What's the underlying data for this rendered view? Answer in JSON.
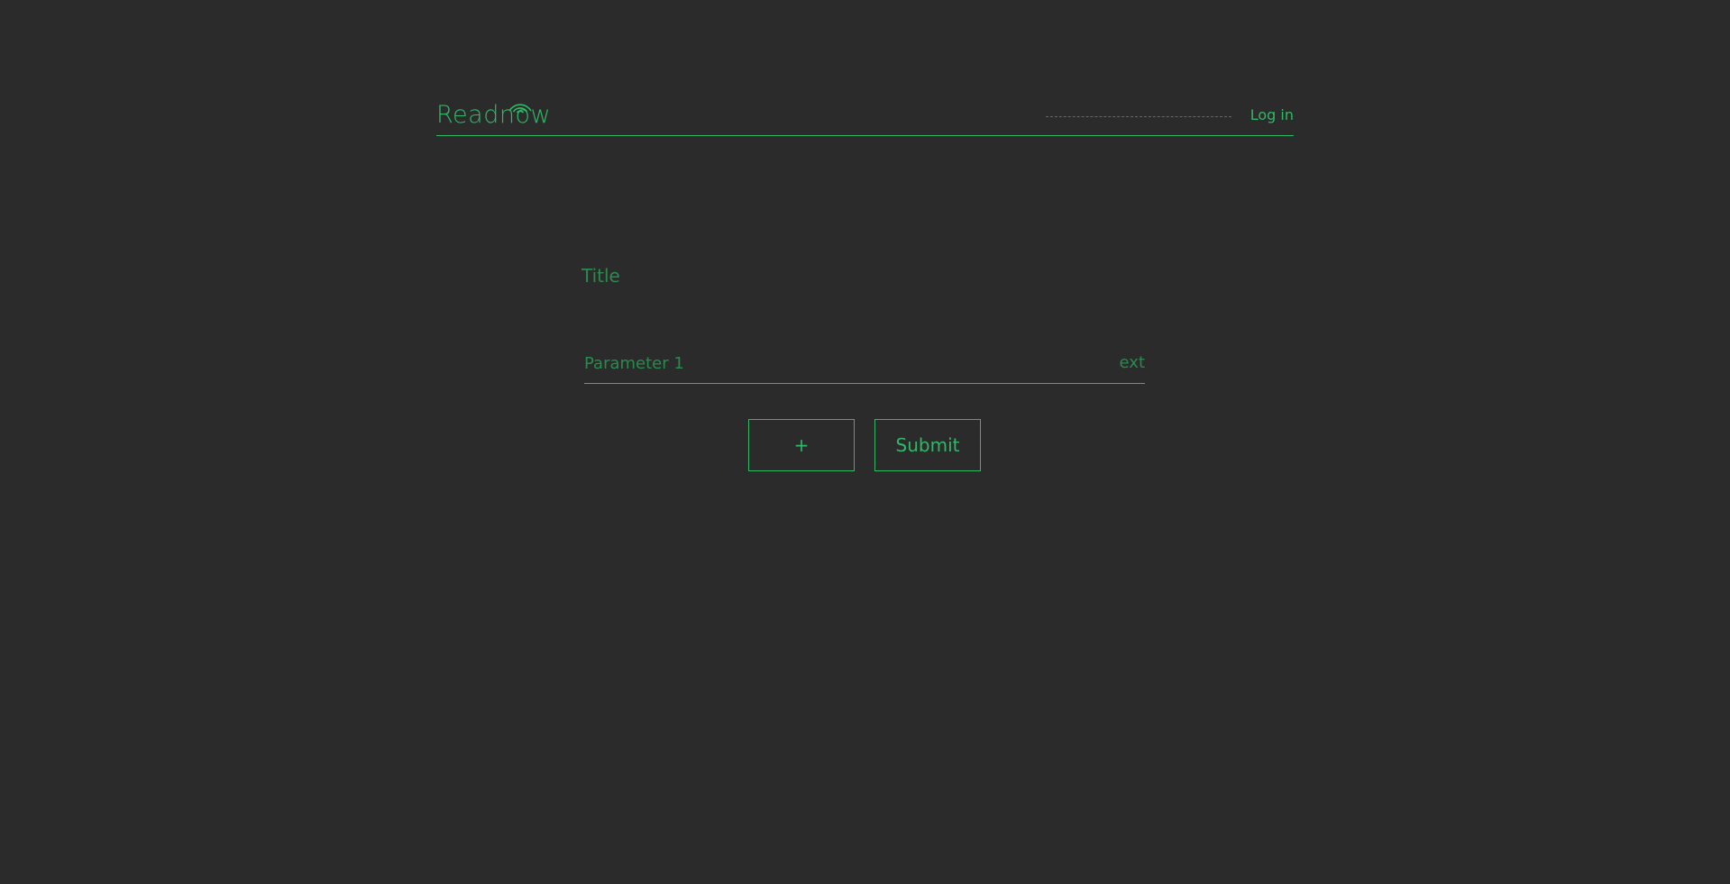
{
  "header": {
    "logo_text": "Readnow",
    "login_label": "Log in",
    "search_placeholder": ""
  },
  "form": {
    "title_placeholder": "Title",
    "parameter_placeholder": "Parameter 1",
    "parameter_suffix": "ext",
    "add_label": "+",
    "submit_label": "Submit"
  },
  "colors": {
    "background": "#2b2b2b",
    "accent": "#2fb866",
    "accent_dim": "#2a8a4e"
  },
  "icons": {
    "logo_icon": "wifi-signal-icon"
  }
}
